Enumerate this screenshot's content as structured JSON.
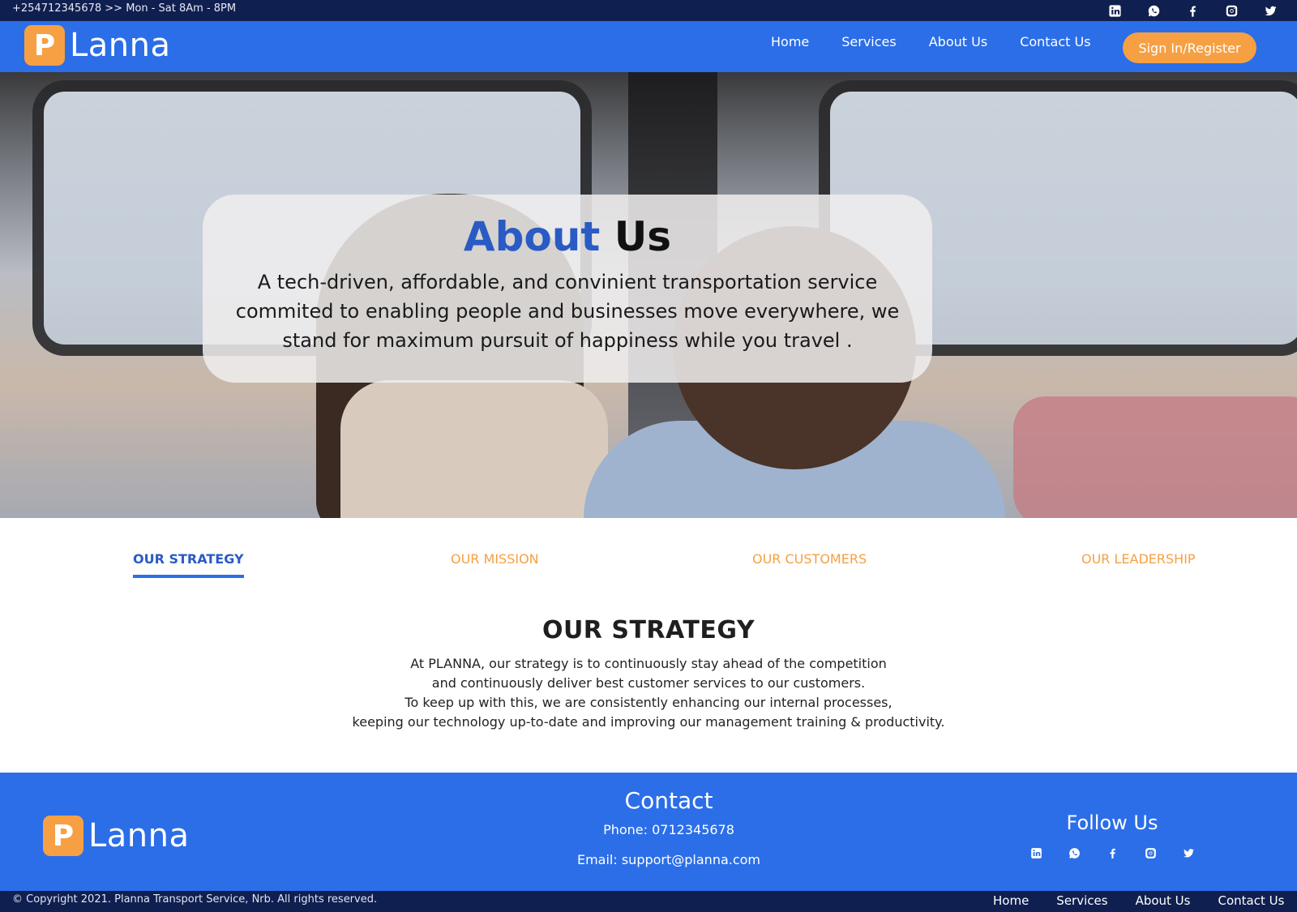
{
  "topbar": {
    "hours": "+254712345678 >> Mon - Sat 8Am - 8PM",
    "social": [
      {
        "icon": "linkedin-icon"
      },
      {
        "icon": "whatsapp-icon"
      },
      {
        "icon": "facebook-icon"
      },
      {
        "icon": "instagram-icon"
      },
      {
        "icon": "twitter-icon"
      }
    ]
  },
  "header": {
    "logo_letter": "P",
    "logo_word": "Lanna",
    "nav": [
      "Home",
      "Services",
      "About Us",
      "Contact Us"
    ],
    "signin_label": "Sign In/Register"
  },
  "hero": {
    "title_highlight": "About",
    "title_rest": "Us",
    "description": "A tech-driven, affordable, and convinient transportation service commited to enabling people and businesses move everywhere, we stand for maximum pursuit of happiness while you travel ."
  },
  "tabs": [
    {
      "label": "OUR STRATEGY",
      "active": true
    },
    {
      "label": "OUR MISSION",
      "active": false
    },
    {
      "label": "OUR CUSTOMERS",
      "active": false
    },
    {
      "label": "OUR LEADERSHIP",
      "active": false
    }
  ],
  "content": {
    "heading": "OUR STRATEGY",
    "lines": [
      "At PLANNA, our strategy is to continuously stay ahead of the competition",
      "and continuously deliver best customer services to our customers.",
      "To keep up with this, we are consistently enhancing our internal processes,",
      "keeping our technology up-to-date and improving our management training & productivity."
    ]
  },
  "footer": {
    "logo_letter": "P",
    "logo_word": "Lanna",
    "contact_title": "Contact",
    "phone": "Phone: 0712345678",
    "email": "Email: support@planna.com",
    "follow_title": "Follow Us"
  },
  "bottombar": {
    "copyright": "© Copyright 2021. Planna Transport Service, Nrb. All rights reserved.",
    "nav": [
      "Home",
      "Services",
      "About Us",
      "Contact Us"
    ]
  },
  "colors": {
    "primary": "#2b6ee8",
    "dark": "#0f1f4f",
    "accent": "#f6a043",
    "title_blue": "#2a5bc4"
  }
}
